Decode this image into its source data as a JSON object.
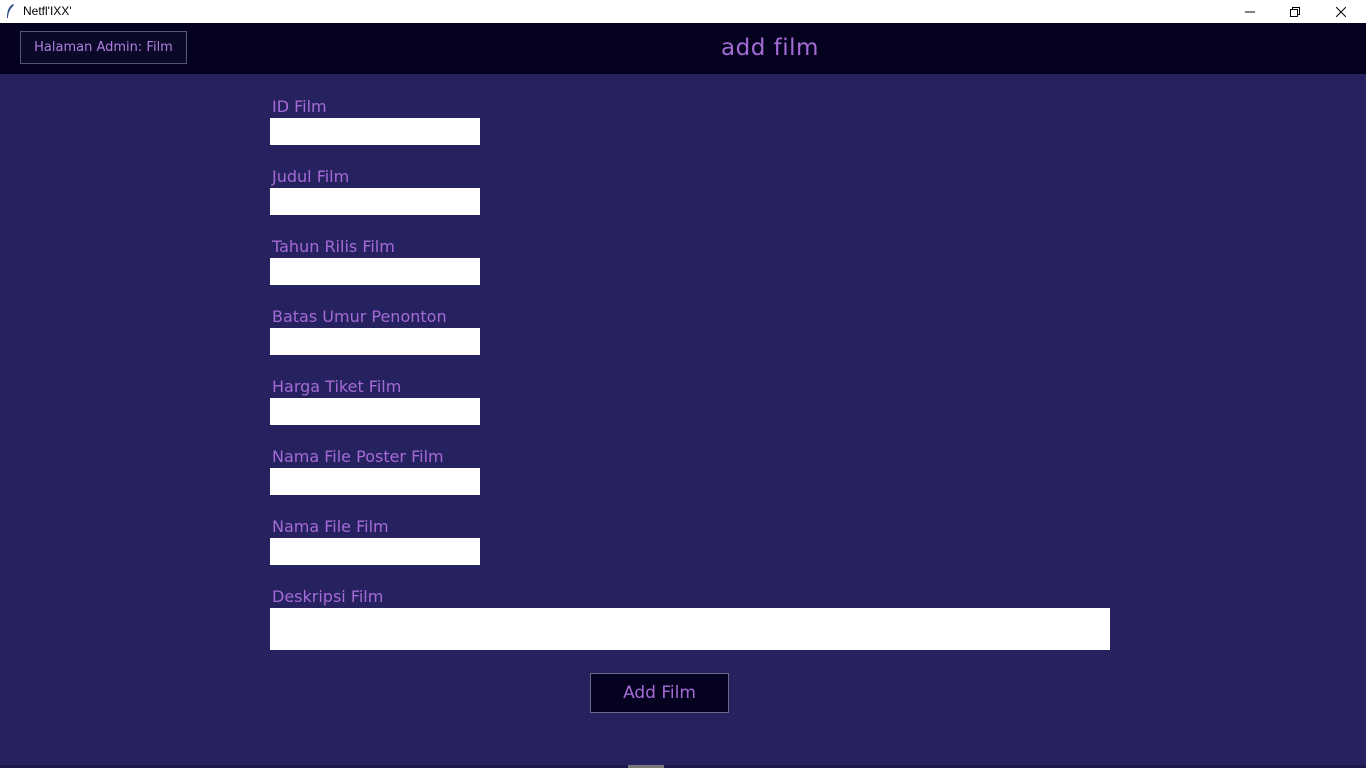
{
  "window": {
    "title": "Netfl'IXX'",
    "icons": {
      "app": "feather-icon",
      "minimize": "minimize-icon",
      "restore": "restore-icon",
      "close": "close-icon"
    }
  },
  "header": {
    "admin_button_label": "Halaman Admin: Film",
    "page_title": "add film"
  },
  "form": {
    "fields": [
      {
        "label": "ID Film",
        "value": ""
      },
      {
        "label": "Judul Film",
        "value": ""
      },
      {
        "label": "Tahun Rilis Film",
        "value": ""
      },
      {
        "label": "Batas Umur Penonton",
        "value": ""
      },
      {
        "label": "Harga Tiket Film",
        "value": ""
      },
      {
        "label": "Nama File Poster Film",
        "value": ""
      },
      {
        "label": "Nama File Film",
        "value": ""
      }
    ],
    "description": {
      "label": "Deskripsi Film",
      "value": ""
    },
    "submit_label": "Add Film"
  },
  "colors": {
    "background": "#26215f",
    "header": "#04021f",
    "accent": "#a46bd6"
  }
}
